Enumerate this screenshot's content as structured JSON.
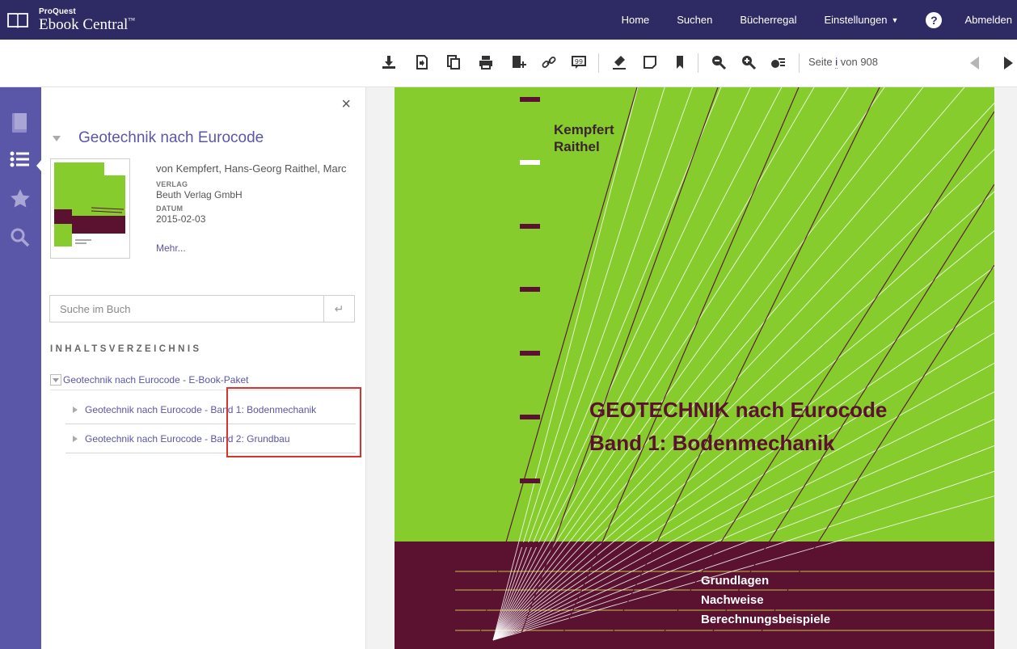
{
  "brand": {
    "small": "ProQuest",
    "main": "Ebook Central",
    "tm": "™"
  },
  "nav": {
    "home": "Home",
    "search": "Suchen",
    "bookshelf": "Bücherregal",
    "settings": "Einstellungen",
    "help": "?",
    "logout": "Abmelden"
  },
  "toolbar": {
    "icons": [
      "download-icon",
      "copy-icon",
      "pages-icon",
      "print-icon",
      "add-to-shelf-icon",
      "link-icon",
      "citation-icon",
      "highlight-icon",
      "note-icon",
      "bookmark-icon",
      "zoom-out-icon",
      "zoom-in-icon",
      "fit-page-icon"
    ],
    "page_prefix": "Seite ",
    "page_value": "i",
    "page_suffix": " von 908"
  },
  "rail": {
    "icons": [
      "book-info-icon",
      "table-of-contents-icon",
      "favorites-star-icon",
      "search-icon"
    ],
    "active": "table-of-contents-icon"
  },
  "panel": {
    "close": "×",
    "book_title": "Geotechnik nach Eurocode",
    "author": "von Kempfert, Hans-Georg Raithel, Marc",
    "publisher_label": "VERLAG",
    "publisher": "Beuth Verlag GmbH",
    "date_label": "DATUM",
    "date": "2015-02-03",
    "more": "Mehr..."
  },
  "search_in_book": {
    "placeholder": "Suche im Buch"
  },
  "toc": {
    "heading": "INHALTSVERZEICHNIS",
    "root": "Geotechnik nach Eurocode - E-Book-Paket",
    "children": [
      "Geotechnik nach Eurocode - Band 1: Bodenmechanik",
      "Geotechnik nach Eurocode - Band 2: Grundbau"
    ]
  },
  "cover": {
    "author1": "Kempfert",
    "author2": "Raithel",
    "title1": "GEOTECHNIK nach Eurocode",
    "title2": "Band 1: Bodenmechanik",
    "subtitles": [
      "Grundlagen",
      "Nachweise",
      "Berechnungsbeispiele"
    ],
    "colors": {
      "green": "#86cc2c",
      "maroon": "#5a1230",
      "line": "#5a1230"
    }
  },
  "colors": {
    "nav": "#2e2a63",
    "rail": "#5a56a8",
    "accent": "#5a56a8",
    "highlight": "#d8332c"
  }
}
